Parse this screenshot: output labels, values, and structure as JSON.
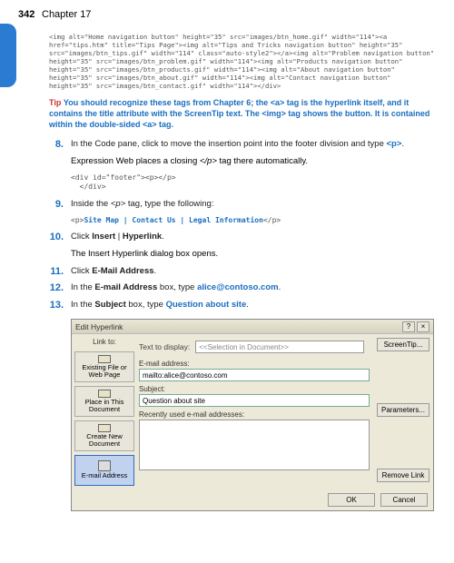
{
  "header": {
    "page_num": "342",
    "chapter": "Chapter  17"
  },
  "code1": "<img alt=\"Home navigation button\" height=\"35\" src=\"images/btn_home.gif\" width=\"114\"><a href=\"tips.htm\" title=\"Tips Page\"><img alt=\"Tips and Tricks navigation button\" height=\"35\" src=\"images/btn_tips.gif\" width=\"114\" class=\"auto-style2\"></a><img alt=\"Problem navigation button\" height=\"35\" src=\"images/btn_problem.gif\" width=\"114\"><img alt=\"Products navigation button\" height=\"35\" src=\"images/btn_products.gif\" width=\"114\"><img alt=\"About navigation button\" height=\"35\" src=\"images/btn_about.gif\" width=\"114\"><img alt=\"Contact navigation button\" height=\"35\" src=\"images/btn_contact.gif\" width=\"114\"></div>",
  "tip": {
    "label": "Tip",
    "text": "You should recognize these tags from Chapter 6; the <a> tag is the hyperlink itself, and it contains the title attribute with the ScreenTip text. The <img> tag shows the button. It is contained within the double-sided <a> tag."
  },
  "steps": {
    "s8": {
      "num": "8.",
      "text_a": "In the Code pane, click to move the insertion point into the footer division and type ",
      "kw": "<p>",
      "text_b": "."
    },
    "s8_sub": {
      "a": "Expression Web places a closing ",
      "it": "</p>",
      "b": " tag there automatically."
    },
    "code8": "<div id=\"footer\"><p></p>\n  </div>",
    "s9": {
      "num": "9.",
      "a": "Inside the ",
      "it": "<p>",
      "b": " tag, type the following:"
    },
    "code9_plain": "<p>",
    "code9_hl": "Site Map | Contact Us | Legal Information",
    "code9_end": "</p>",
    "s10": {
      "num": "10.",
      "a": "Click ",
      "b1": "Insert",
      "sep": " | ",
      "b2": "Hyperlink",
      "end": "."
    },
    "s10_sub": "The Insert Hyperlink dialog box opens.",
    "s11": {
      "num": "11.",
      "a": "Click ",
      "b": "E-Mail Address",
      "end": "."
    },
    "s12": {
      "num": "12.",
      "a": "In the ",
      "b": "E-mail Address",
      "mid": " box, type ",
      "kw": "alice@contoso.com",
      "end": "."
    },
    "s13": {
      "num": "13.",
      "a": "In the ",
      "b": "Subject",
      "mid": " box, type ",
      "kw": "Question about site",
      "end": "."
    }
  },
  "dialog": {
    "title": "Edit Hyperlink",
    "linkto_label": "Link to:",
    "text_display_label": "Text to display:",
    "text_display_value": "<<Selection in Document>>",
    "nav": {
      "existing": "Existing File or Web Page",
      "place": "Place in This Document",
      "create": "Create New Document",
      "email": "E-mail Address"
    },
    "fields": {
      "email_label": "E-mail address:",
      "email_value": "mailto:alice@contoso.com",
      "subject_label": "Subject:",
      "subject_value": "Question about site",
      "recent_label": "Recently used e-mail addresses:"
    },
    "buttons": {
      "screentip": "ScreenTip...",
      "parameters": "Parameters...",
      "remove": "Remove Link",
      "ok": "OK",
      "cancel": "Cancel"
    }
  }
}
